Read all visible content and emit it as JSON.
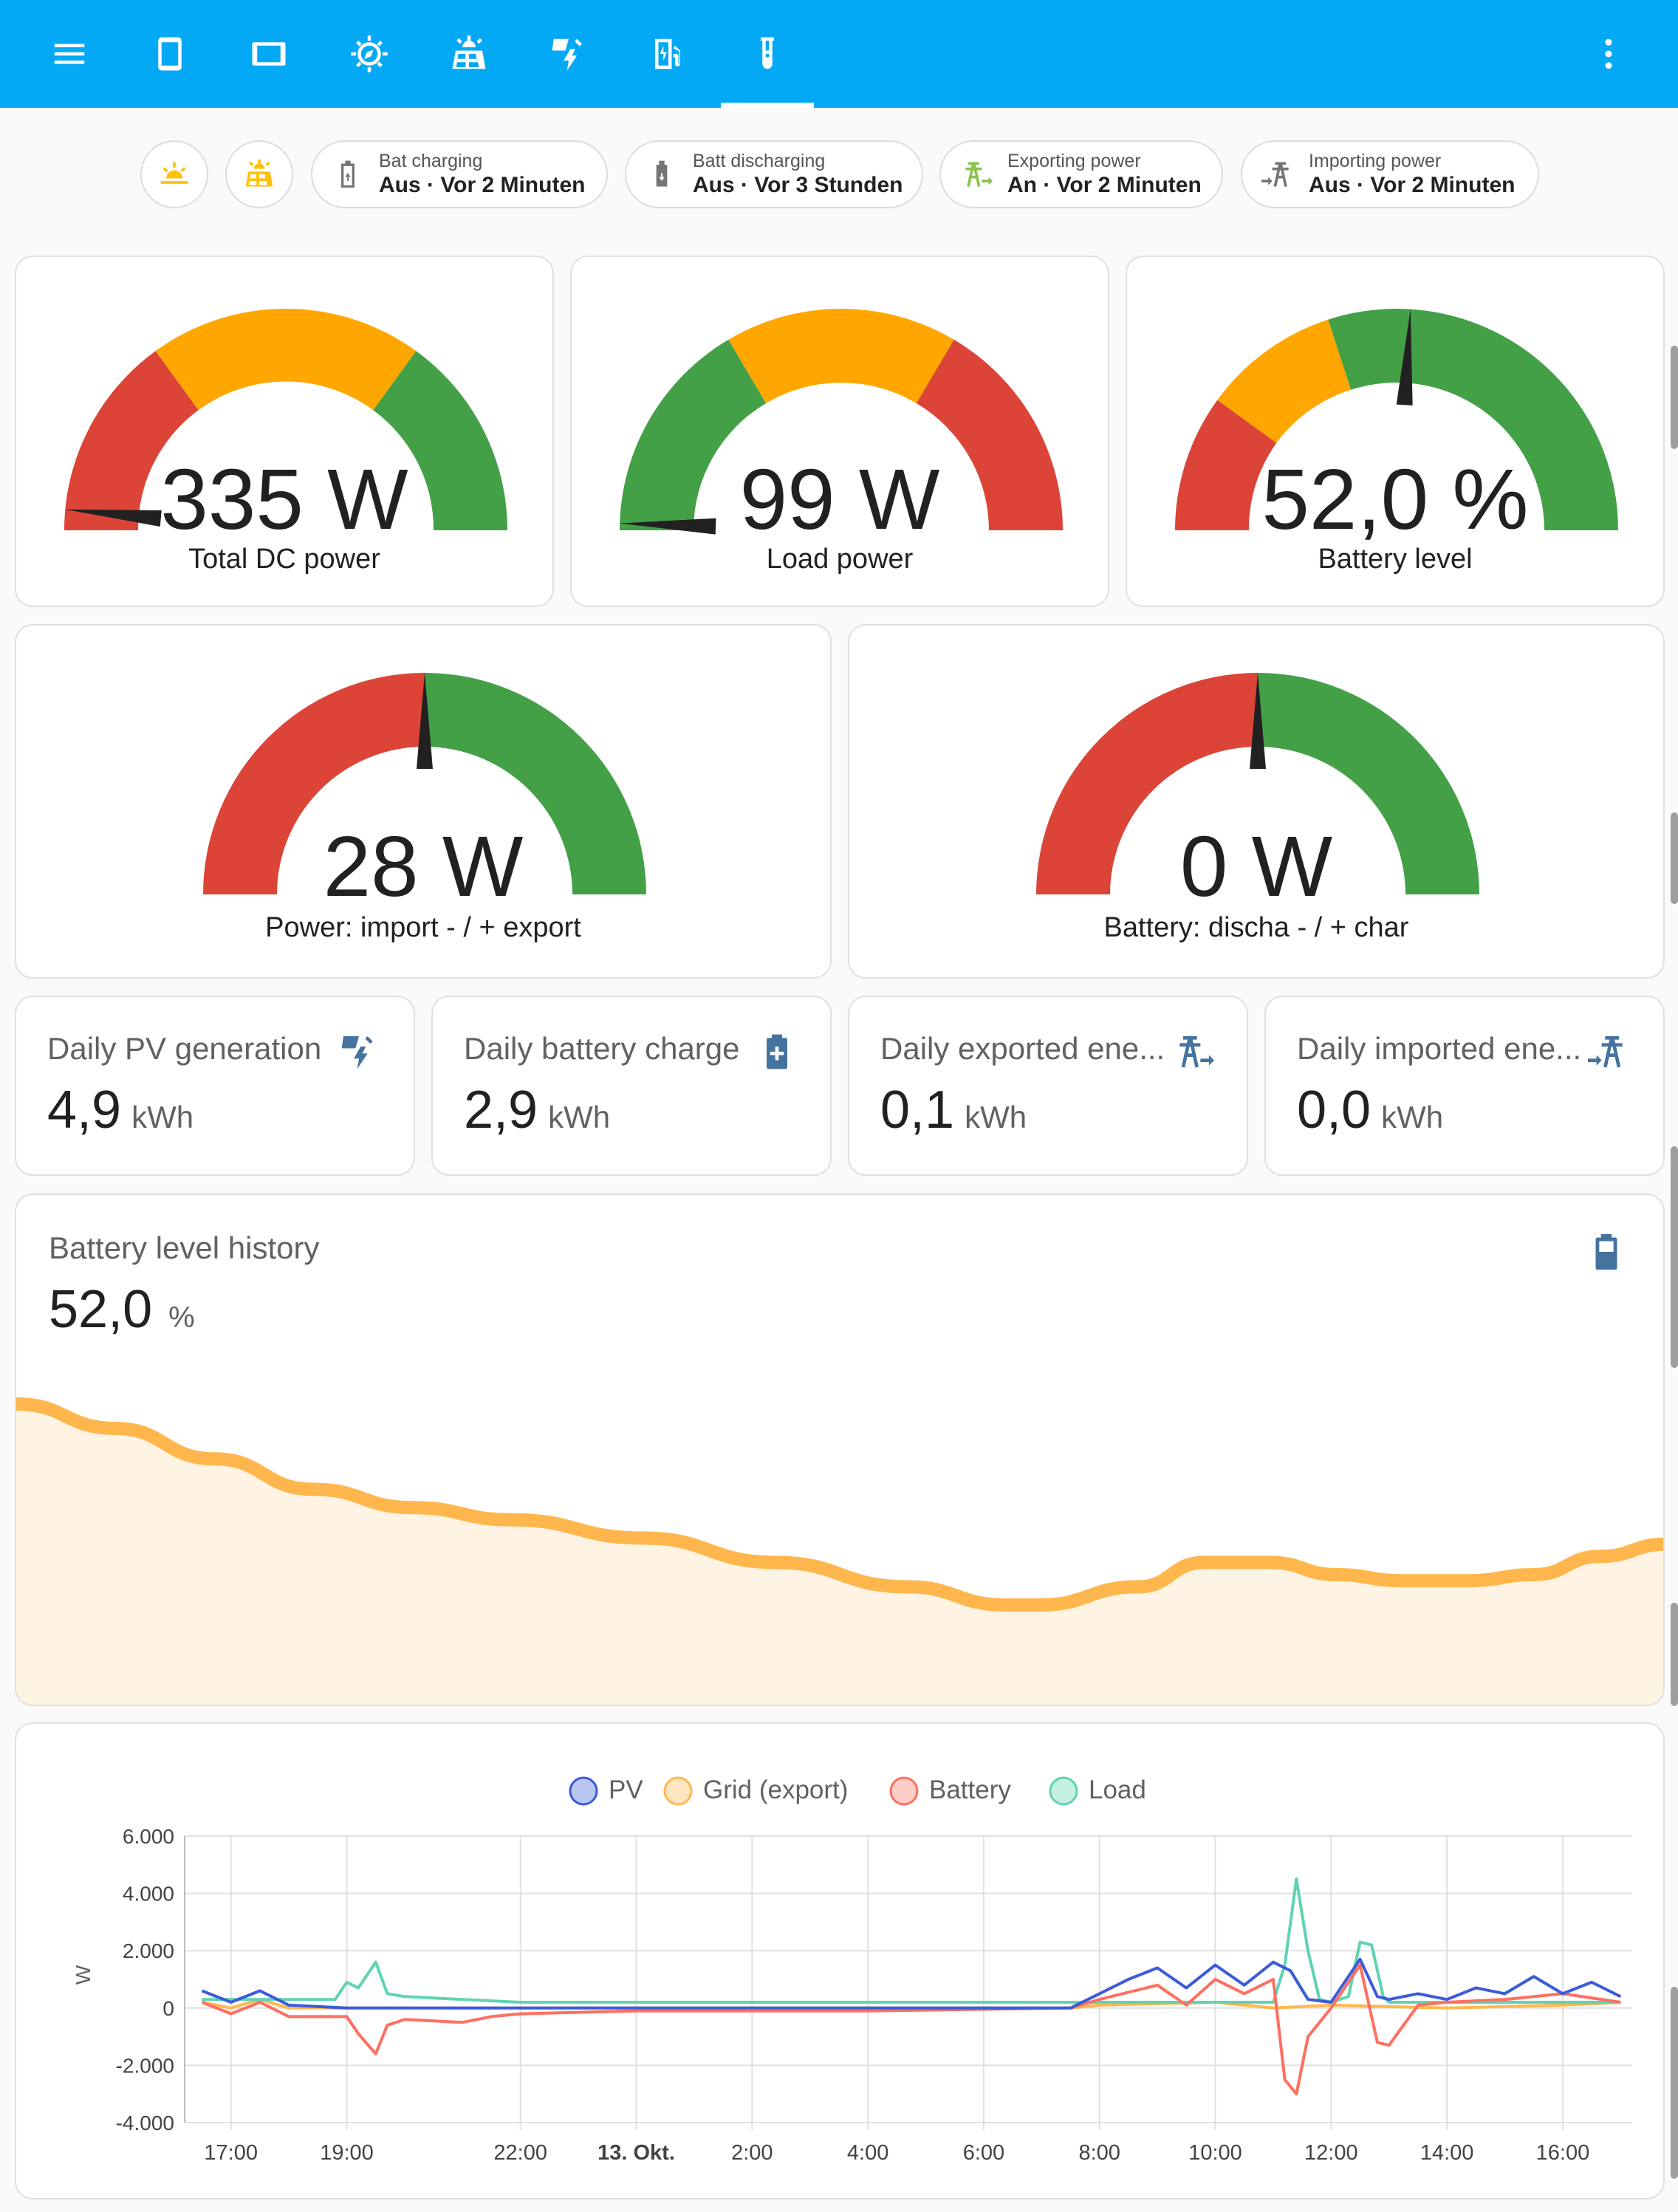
{
  "colors": {
    "topbar": "#03a9f4",
    "gauge_red": "#db4437",
    "gauge_orange": "#ffa600",
    "gauge_green": "#43a047",
    "icon_blue": "#44739e",
    "pv": "#3b5bdb",
    "grid": "#ffb84d",
    "battery": "#ff6f61",
    "load": "#5fd3b3"
  },
  "toolbar": {
    "tabs": [
      "menu-icon",
      "phone-icon",
      "tablet-icon",
      "sun-compass-icon",
      "solar-panel-icon",
      "solar-power-icon",
      "ev-station-icon",
      "test-tube-icon"
    ],
    "active_tab": 7,
    "overflow": "more-vertical-icon"
  },
  "chips": [
    {
      "icon": "sun-icon"
    },
    {
      "icon": "solar-panel-icon"
    },
    {
      "name": "Bat charging",
      "state": "Aus · Vor 2 Minuten",
      "icon": "battery-charging-icon"
    },
    {
      "name": "Batt discharging",
      "state": "Aus · Vor 3 Stunden",
      "icon": "battery-discharging-icon"
    },
    {
      "name": "Exporting power",
      "state": "An · Vor 2 Minuten",
      "icon": "transmission-tower-export-icon"
    },
    {
      "name": "Importing power",
      "state": "Aus · Vor 2 Minuten",
      "icon": "transmission-tower-import-icon"
    }
  ],
  "gauges": [
    {
      "value": "335 W",
      "name": "Total DC power",
      "level": 0.03
    },
    {
      "value": "99 W",
      "name": "Load power",
      "level": 0.01
    },
    {
      "value": "52,0 %",
      "name": "Battery level",
      "level": 0.52
    },
    {
      "value": "28 W",
      "name": "Power: import - / + export",
      "level": 0.5
    },
    {
      "value": "0 W",
      "name": "Battery: discha - / + char",
      "level": 0.5
    }
  ],
  "stats": [
    {
      "name": "Daily PV generation",
      "value": "4,9",
      "unit": "kWh",
      "icon": "solar-power-icon"
    },
    {
      "name": "Daily battery charge",
      "value": "2,9",
      "unit": "kWh",
      "icon": "battery-plus-icon"
    },
    {
      "name": "Daily exported ene...",
      "value": "0,1",
      "unit": "kWh",
      "icon": "transmission-tower-export-icon"
    },
    {
      "name": "Daily imported ene...",
      "value": "0,0",
      "unit": "kWh",
      "icon": "transmission-tower-import-icon"
    }
  ],
  "history": {
    "title": "Battery level history",
    "value": "52,0",
    "unit": "%",
    "icon": "battery-icon"
  },
  "chart_data": {
    "type": "line",
    "ylabel": "W",
    "ylim": [
      -4000,
      6000
    ],
    "yticks": [
      "6.000",
      "4.000",
      "2.000",
      "0",
      "-2.000",
      "-4.000"
    ],
    "xtick_labels": [
      "17:00",
      "19:00",
      "22:00",
      "13. Okt.",
      "2:00",
      "4:00",
      "6:00",
      "8:00",
      "10:00",
      "12:00",
      "14:00",
      "16:00"
    ],
    "legend": [
      "PV",
      "Grid (export)",
      "Battery",
      "Load"
    ],
    "grid": true,
    "legend_position": "top-center",
    "series": [
      {
        "name": "PV",
        "x": [
          16.5,
          17.0,
          17.5,
          18.0,
          19.0,
          20.0,
          21.0,
          22.0,
          24.0,
          26.0,
          28.0,
          30.0,
          31.5,
          32.0,
          32.5,
          33.0,
          33.5,
          34.0,
          34.5,
          35.0,
          35.3,
          35.6,
          36.0,
          36.5,
          36.8,
          37.0,
          37.5,
          38.0,
          38.5,
          39.0,
          39.5,
          40.0,
          40.5,
          41.0
        ],
        "values": [
          600,
          200,
          600,
          100,
          0,
          0,
          0,
          0,
          0,
          0,
          0,
          0,
          0,
          500,
          1000,
          1400,
          700,
          1500,
          800,
          1600,
          1300,
          300,
          200,
          1700,
          400,
          300,
          500,
          300,
          700,
          500,
          1100,
          500,
          900,
          400
        ]
      },
      {
        "name": "Grid (export)",
        "x": [
          16.5,
          17.0,
          17.5,
          18.0,
          19.0,
          24.0,
          31.5,
          32.0,
          34.0,
          35.0,
          36.0,
          38.0,
          40.0,
          41.0
        ],
        "values": [
          200,
          0,
          300,
          0,
          0,
          0,
          0,
          100,
          200,
          0,
          100,
          0,
          100,
          200
        ]
      },
      {
        "name": "Battery",
        "x": [
          16.5,
          17.0,
          17.5,
          18.0,
          19.0,
          19.2,
          19.5,
          19.7,
          20.0,
          21.0,
          21.5,
          22.0,
          24.0,
          28.0,
          31.5,
          32.0,
          33.0,
          33.5,
          34.0,
          34.5,
          35.0,
          35.2,
          35.4,
          35.6,
          36.0,
          36.5,
          36.8,
          37.0,
          37.5,
          38.0,
          39.0,
          40.0,
          41.0
        ],
        "values": [
          200,
          -200,
          200,
          -300,
          -300,
          -900,
          -1600,
          -600,
          -400,
          -500,
          -300,
          -200,
          -100,
          -100,
          0,
          300,
          800,
          100,
          1000,
          500,
          1000,
          -2500,
          -3000,
          -1000,
          0,
          1500,
          -1200,
          -1300,
          100,
          200,
          300,
          500,
          200
        ]
      },
      {
        "name": "Load",
        "x": [
          16.5,
          17.0,
          18.0,
          18.8,
          19.0,
          19.2,
          19.5,
          19.7,
          20.0,
          21.0,
          22.0,
          24.0,
          28.0,
          31.5,
          32.0,
          34.0,
          35.0,
          35.2,
          35.4,
          35.6,
          35.8,
          36.0,
          36.3,
          36.5,
          36.7,
          36.9,
          37.0,
          38.0,
          40.0,
          41.0
        ],
        "values": [
          300,
          300,
          300,
          300,
          900,
          700,
          1600,
          500,
          400,
          300,
          200,
          200,
          200,
          200,
          200,
          200,
          200,
          1500,
          4500,
          2000,
          300,
          200,
          400,
          2300,
          2200,
          400,
          200,
          200,
          200,
          200
        ]
      }
    ]
  },
  "history_chart": {
    "type": "area",
    "x": [
      0,
      0.06,
      0.12,
      0.18,
      0.24,
      0.3,
      0.38,
      0.46,
      0.54,
      0.6,
      0.62,
      0.68,
      0.72,
      0.76,
      0.8,
      0.84,
      0.88,
      0.92,
      0.96,
      1.0
    ],
    "values": [
      86,
      82,
      77,
      72,
      69,
      67,
      64,
      60,
      56,
      53,
      53,
      56,
      60,
      60,
      58,
      57,
      57,
      58,
      61,
      63
    ]
  }
}
